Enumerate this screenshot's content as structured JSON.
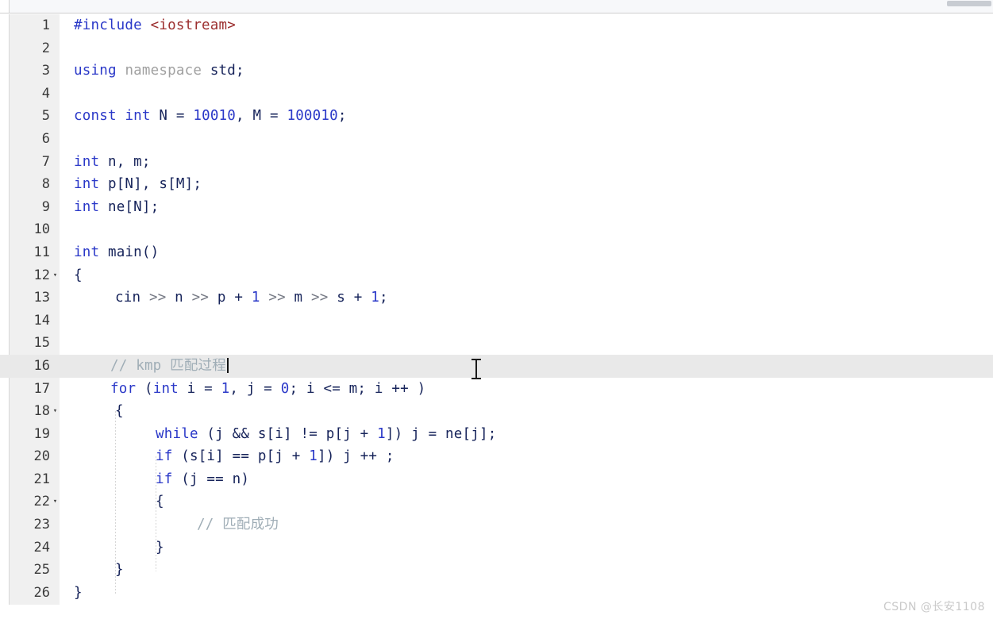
{
  "window": {
    "kind": "code-editor",
    "language": "C++"
  },
  "watermark": "CSDN @长安1108",
  "colors": {
    "keyword": "#2a38c8",
    "number": "#2a38c8",
    "string": "#9c2f2f",
    "comment": "#9fadb6",
    "identifier": "#16235a",
    "operator": "#777b86",
    "gutter_bg": "#f0f0f0",
    "active_line_bg": "#e9e9e9",
    "editor_bg": "#ffffff"
  },
  "editor": {
    "active_line": 16,
    "caret_line": 16,
    "caret_column": 17,
    "fold_lines": [
      12,
      18,
      22
    ],
    "fold_marker": "▾",
    "line_count": 26
  },
  "lines": [
    {
      "n": "1",
      "text": "#include <iostream>"
    },
    {
      "n": "2",
      "text": ""
    },
    {
      "n": "3",
      "text": "using namespace std;"
    },
    {
      "n": "4",
      "text": ""
    },
    {
      "n": "5",
      "text": "const int N = 10010, M = 100010;"
    },
    {
      "n": "6",
      "text": ""
    },
    {
      "n": "7",
      "text": "int n, m;"
    },
    {
      "n": "8",
      "text": "int p[N], s[M];"
    },
    {
      "n": "9",
      "text": "int ne[N];"
    },
    {
      "n": "10",
      "text": ""
    },
    {
      "n": "11",
      "text": "int main()"
    },
    {
      "n": "12",
      "text": "{"
    },
    {
      "n": "13",
      "text": "    cin >> n >> p + 1 >> m >> s + 1;"
    },
    {
      "n": "14",
      "text": ""
    },
    {
      "n": "15",
      "text": ""
    },
    {
      "n": "16",
      "text": "    // kmp 匹配过程"
    },
    {
      "n": "17",
      "text": "    for (int i = 1, j = 0; i <= m; i ++ )"
    },
    {
      "n": "18",
      "text": "    {"
    },
    {
      "n": "19",
      "text": "        while (j && s[i] != p[j + 1]) j = ne[j];"
    },
    {
      "n": "20",
      "text": "        if (s[i] == p[j + 1]) j ++ ;"
    },
    {
      "n": "21",
      "text": "        if (j == n)"
    },
    {
      "n": "22",
      "text": "        {"
    },
    {
      "n": "23",
      "text": "            // 匹配成功"
    },
    {
      "n": "24",
      "text": "        }"
    },
    {
      "n": "25",
      "text": "    }"
    },
    {
      "n": "26",
      "text": "}"
    }
  ],
  "tokens": {
    "l1_include": "#include",
    "l1_header": "<iostream>",
    "l3_using": "using",
    "l3_namespace": "namespace",
    "l3_std": "std;",
    "l5_const": "const",
    "l5_int": "int",
    "l5_n": " N = ",
    "l5_num1": "10010",
    "l5_mid": ", M = ",
    "l5_num2": "100010",
    "l5_end": ";",
    "l7_int": "int",
    "l7_rest": " n, m;",
    "l8_int": "int",
    "l8_rest": " p[N], s[M];",
    "l9_int": "int",
    "l9_rest": " ne[N];",
    "l11_int": "int",
    "l11_rest": " main()",
    "l12_brace": "{",
    "l13_cin": "cin ",
    "l13_op1": ">>",
    "l13_n": " n ",
    "l13_op2": ">>",
    "l13_p": " p + ",
    "l13_num1": "1",
    "l13_sp1": " ",
    "l13_op3": ">>",
    "l13_m": " m ",
    "l13_op4": ">>",
    "l13_s": " s + ",
    "l13_num2": "1",
    "l13_end": ";",
    "l16_comment": "// kmp 匹配过程",
    "l17_for": "for",
    "l17_p1": " (",
    "l17_int": "int",
    "l17_i": " i = ",
    "l17_num1": "1",
    "l17_j": ", j = ",
    "l17_num0": "0",
    "l17_rest": "; i <= m; i ++ )",
    "l18_brace": "{",
    "l19_while": "while",
    "l19_rest": " (j && s[i] != p[j + ",
    "l19_num1": "1",
    "l19_tail": "]) j = ne[j];",
    "l20_if": "if",
    "l20_rest": " (s[i] == p[j + ",
    "l20_num1": "1",
    "l20_tail": "]) j ++ ;",
    "l21_if": "if",
    "l21_rest": " (j == n)",
    "l22_brace": "{",
    "l23_comment": "// 匹配成功",
    "l24_brace": "}",
    "l25_brace": "}",
    "l26_brace": "}"
  }
}
